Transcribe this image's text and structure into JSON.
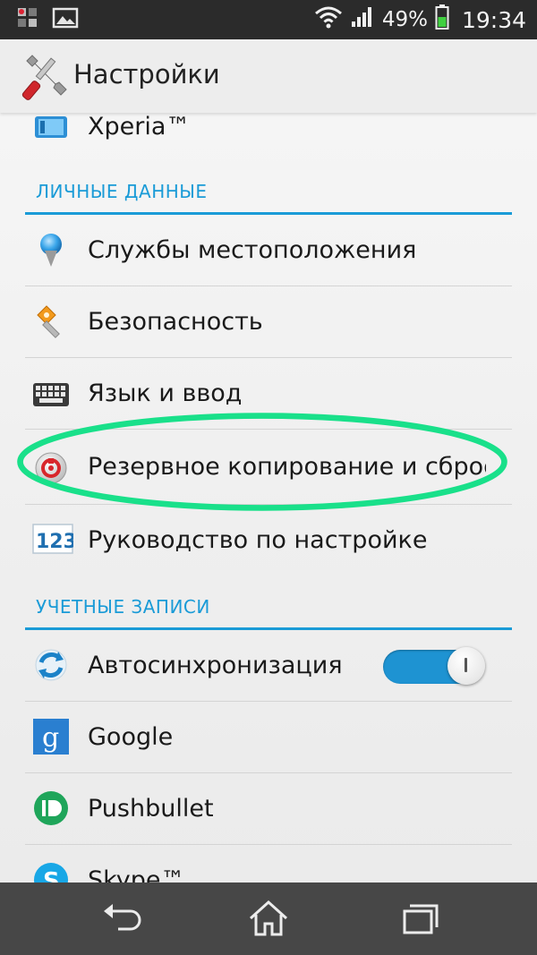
{
  "status_bar": {
    "notification_icons": [
      "app-notification-icon",
      "gallery-icon"
    ],
    "battery_percent": "49%",
    "time": "19:34",
    "battery_color": "#3fcf3f"
  },
  "action_bar": {
    "title": "Настройки",
    "icon": "settings-tools-icon"
  },
  "list": {
    "items": [
      {
        "label": "Xperia™",
        "icon": "xperia-icon"
      },
      {
        "label": "Службы местоположения",
        "icon": "location-pin-icon"
      },
      {
        "label": "Безопасность",
        "icon": "security-key-icon"
      },
      {
        "label": "Язык и ввод",
        "icon": "keyboard-icon"
      },
      {
        "label": "Резервное копирование и сброс",
        "icon": "backup-reset-icon"
      },
      {
        "label": "Руководство по настройке",
        "icon": "setup-guide-123-icon"
      },
      {
        "label": "Автосинхронизация",
        "icon": "sync-icon",
        "toggle_on": true
      },
      {
        "label": "Google",
        "icon": "google-icon"
      },
      {
        "label": "Pushbullet",
        "icon": "pushbullet-icon"
      },
      {
        "label": "Skype™",
        "icon": "skype-icon"
      }
    ],
    "sections": [
      {
        "title": "ЛИЧНЫЕ ДАННЫЕ"
      },
      {
        "title": "УЧЕТНЫЕ ЗАПИСИ"
      }
    ]
  },
  "nav_bar": {
    "buttons": [
      "back-icon",
      "home-icon",
      "recent-apps-icon"
    ]
  },
  "colors": {
    "accent": "#1a9bd7",
    "highlight": "#19e08a"
  }
}
